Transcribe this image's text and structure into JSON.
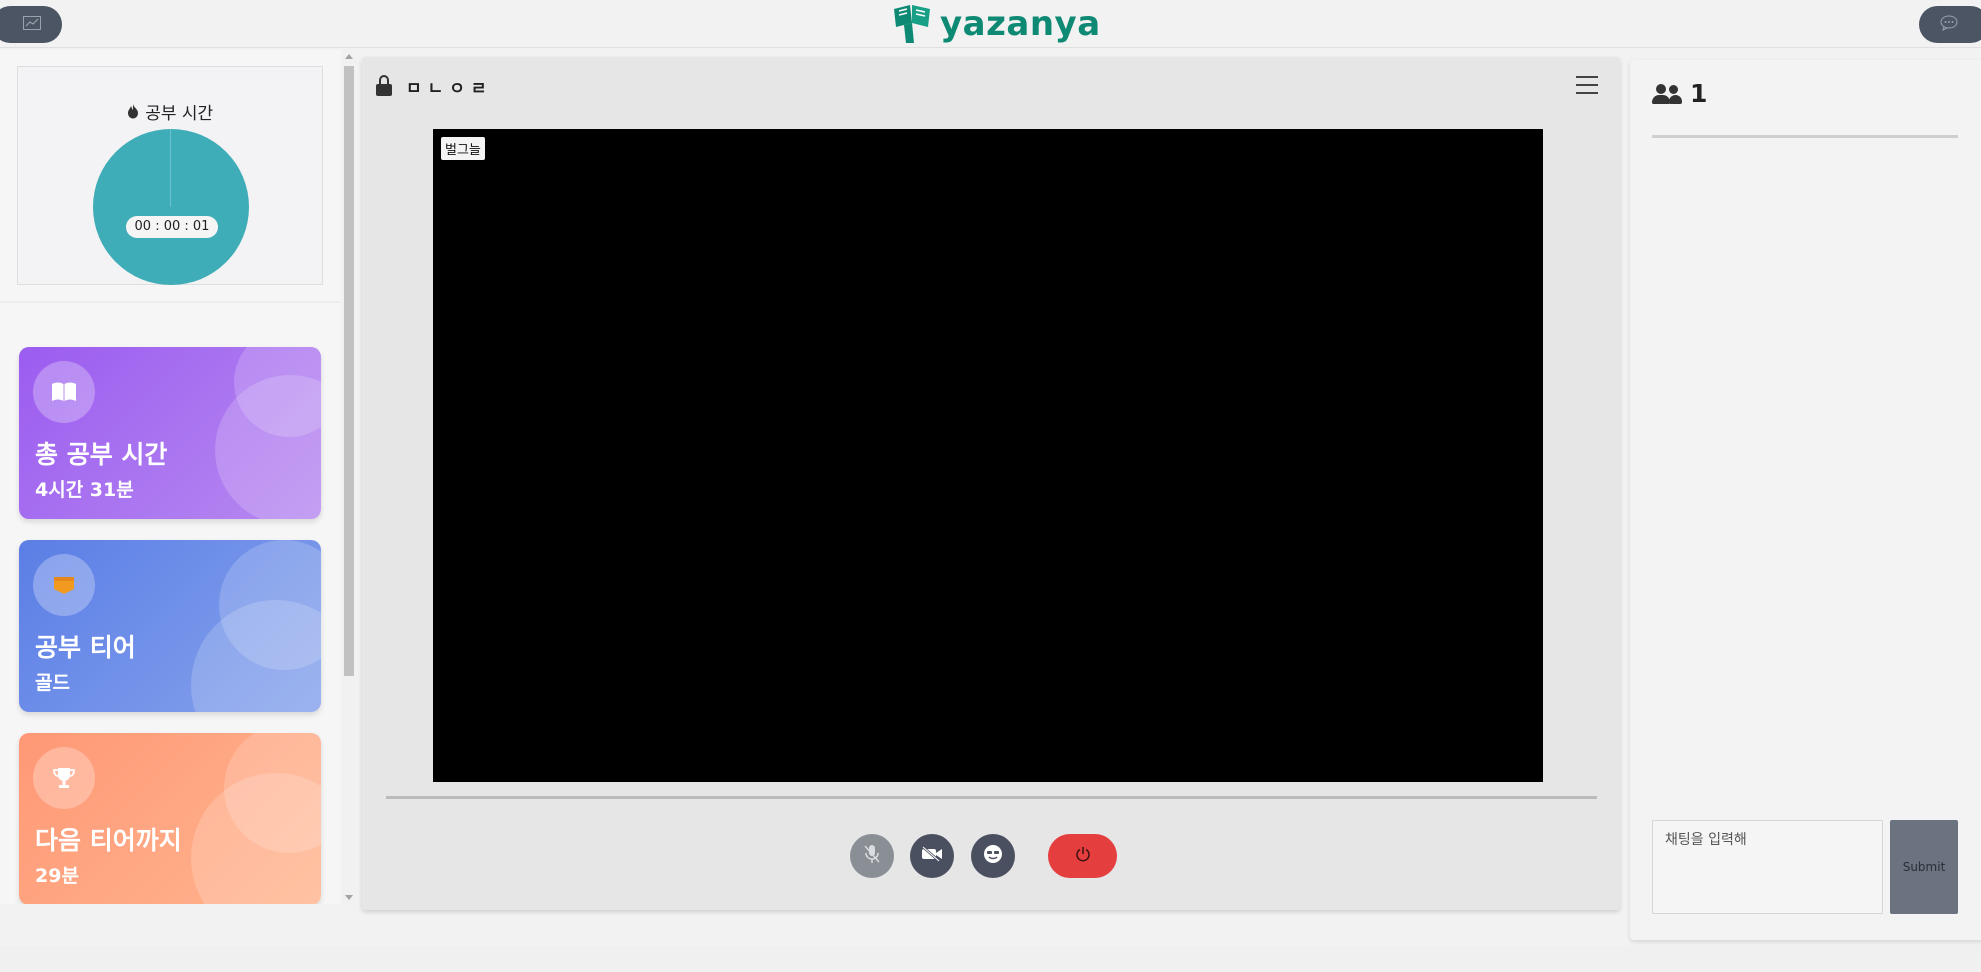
{
  "header": {
    "logo_text": "yazanya",
    "left_button_icon": "chart-icon",
    "right_button_icon": "chat-bubble-icon"
  },
  "timer": {
    "title": "공부 시간",
    "icon": "flame-icon",
    "elapsed": "00 : 00 : 01"
  },
  "stats": [
    {
      "label": "총 공부 시간",
      "value": "4시간 31분",
      "icon": "book-icon",
      "color": "#9b5cf0"
    },
    {
      "label": "공부 티어",
      "value": "골드",
      "icon": "badge-icon",
      "color": "#5b7ee6"
    },
    {
      "label": "다음 티어까지",
      "value": "29분",
      "icon": "trophy-icon",
      "color": "#ff9876"
    }
  ],
  "room": {
    "name": "ㅁㄴㅇㄹ",
    "locked": true,
    "participant_tag": "벌그늘"
  },
  "controls": {
    "mic": "mic-off-icon",
    "camera": "camera-off-icon",
    "face": "face-filter-icon",
    "leave": "power-icon",
    "leave_color": "#e53e3e"
  },
  "members": {
    "count": "1"
  },
  "chat": {
    "placeholder": "채팅을 입력해",
    "submit_label": "Submit"
  }
}
